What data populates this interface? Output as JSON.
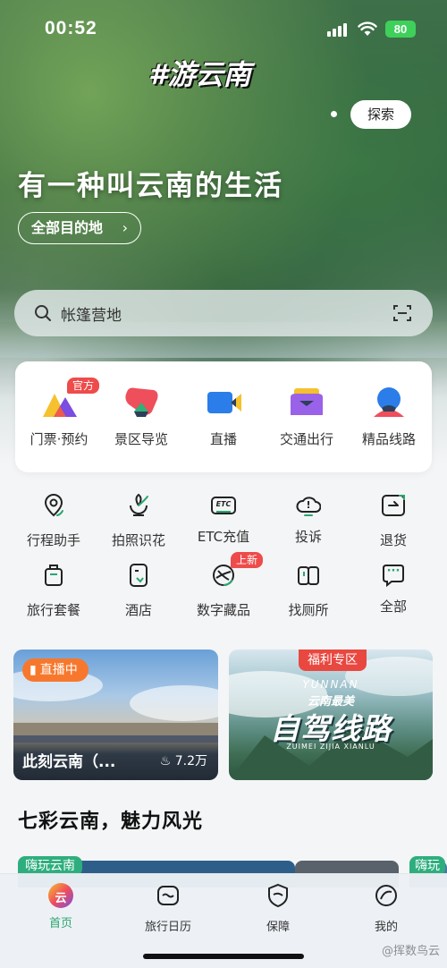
{
  "status": {
    "time": "00:52",
    "battery": "80"
  },
  "hero": {
    "hashtag": "#游云南",
    "explore": "探索",
    "slogan": "有一种叫云南的生活",
    "dest_button": "全部目的地",
    "dest_chevron": "›"
  },
  "search": {
    "placeholder": "帐篷营地"
  },
  "main_card": {
    "items": [
      {
        "label": "门票·预约",
        "icon": "triangles-icon",
        "badge": "官方"
      },
      {
        "label": "景区导览",
        "icon": "map-guide-icon"
      },
      {
        "label": "直播",
        "icon": "video-camera-icon"
      },
      {
        "label": "交通出行",
        "icon": "transport-icon"
      },
      {
        "label": "精品线路",
        "icon": "route-pin-icon"
      }
    ]
  },
  "grid": {
    "row1": [
      {
        "label": "行程助手",
        "icon": "location-pin-icon"
      },
      {
        "label": "拍照识花",
        "icon": "flower-camera-icon"
      },
      {
        "label": "ETC充值",
        "icon": "etc-card-icon",
        "icon_text": "ETC"
      },
      {
        "label": "投诉",
        "icon": "cloud-alert-icon",
        "icon_text": "!"
      },
      {
        "label": "退货",
        "icon": "return-box-icon"
      }
    ],
    "row2": [
      {
        "label": "旅行套餐",
        "icon": "luggage-icon"
      },
      {
        "label": "酒店",
        "icon": "hotel-icon"
      },
      {
        "label": "数字藏品",
        "icon": "digital-collection-icon",
        "badge": "上新"
      },
      {
        "label": "找厕所",
        "icon": "restroom-icon"
      },
      {
        "label": "全部",
        "icon": "more-chat-icon",
        "icon_text": "···"
      }
    ]
  },
  "banners": {
    "live": {
      "badge": "直播中",
      "title": "此刻云南（...",
      "count": "7.2万"
    },
    "drive": {
      "badge": "福利专区",
      "en": "YUNNAN",
      "cn": "云南最美",
      "big": "自驾线路",
      "pinyin": "ZUIMEI ZIJIA XIANLU"
    }
  },
  "section": {
    "title": "七彩云南，魅力风光"
  },
  "peek": {
    "badge_left": "嗨玩云南",
    "badge_right": "嗨玩"
  },
  "tabbar": {
    "tabs": [
      {
        "label": "首页",
        "icon": "home-icon",
        "icon_text": "云",
        "active": true
      },
      {
        "label": "旅行日历",
        "icon": "calendar-icon"
      },
      {
        "label": "保障",
        "icon": "shield-icon"
      },
      {
        "label": "我的",
        "icon": "profile-icon"
      }
    ]
  },
  "watermark": "@挥数鸟云",
  "colors": {
    "accent": "#2aa66f",
    "badge_red": "#ee4b4b",
    "live_orange": "#f7782d"
  }
}
